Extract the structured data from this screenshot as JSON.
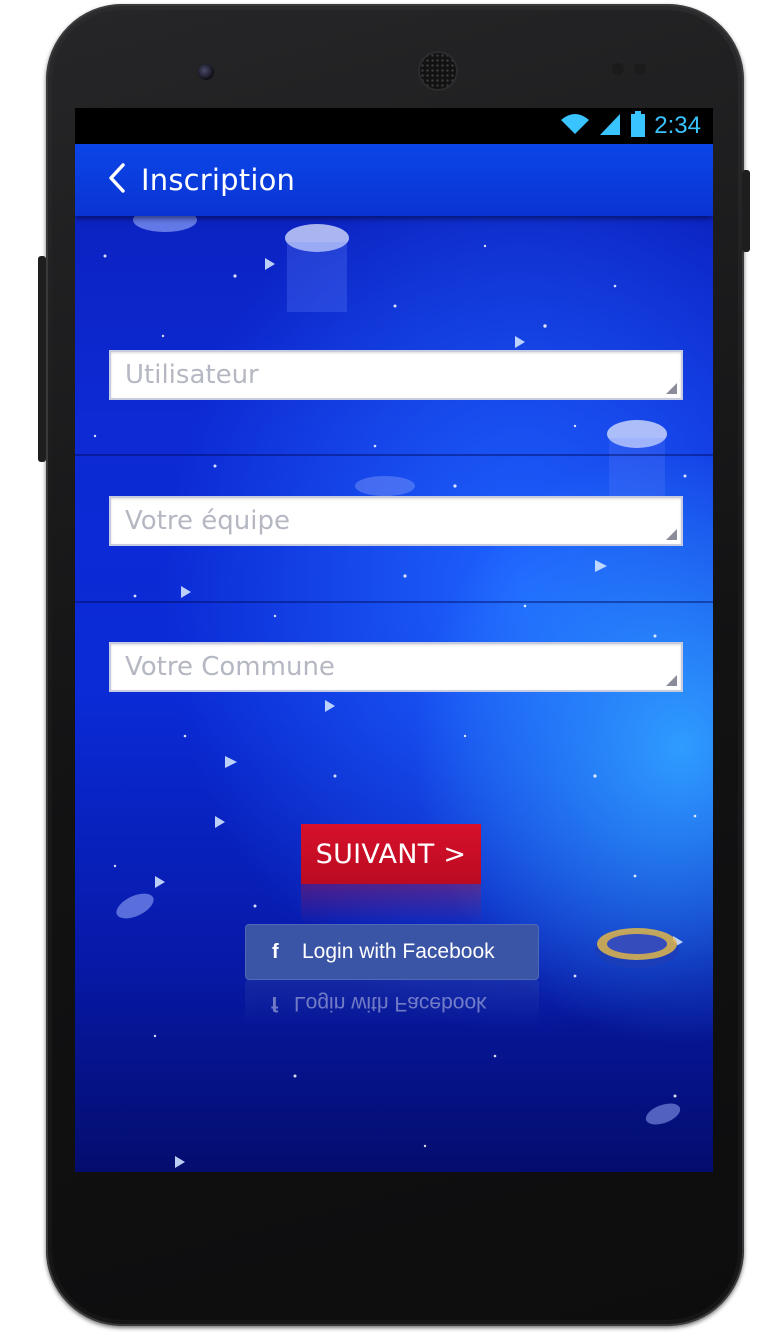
{
  "status_bar": {
    "time": "2:34",
    "icons": [
      "wifi-icon",
      "signal-icon",
      "battery-icon"
    ]
  },
  "app_bar": {
    "back_icon": "chevron-left-icon",
    "title": "Inscription"
  },
  "form": {
    "fields": [
      {
        "placeholder": "Utilisateur",
        "value": ""
      },
      {
        "placeholder": "Votre équipe",
        "value": ""
      },
      {
        "placeholder": "Votre Commune",
        "value": ""
      }
    ]
  },
  "actions": {
    "next_label": "SUIVANT >",
    "facebook_icon": "facebook-icon",
    "facebook_label": "Login with Facebook"
  },
  "colors": {
    "background_blue": "#0a2bd6",
    "appbar_blue": "#0b45e8",
    "next_red": "#c90d26",
    "facebook_blue": "#3b55a6",
    "status_time": "#39c4ff"
  }
}
